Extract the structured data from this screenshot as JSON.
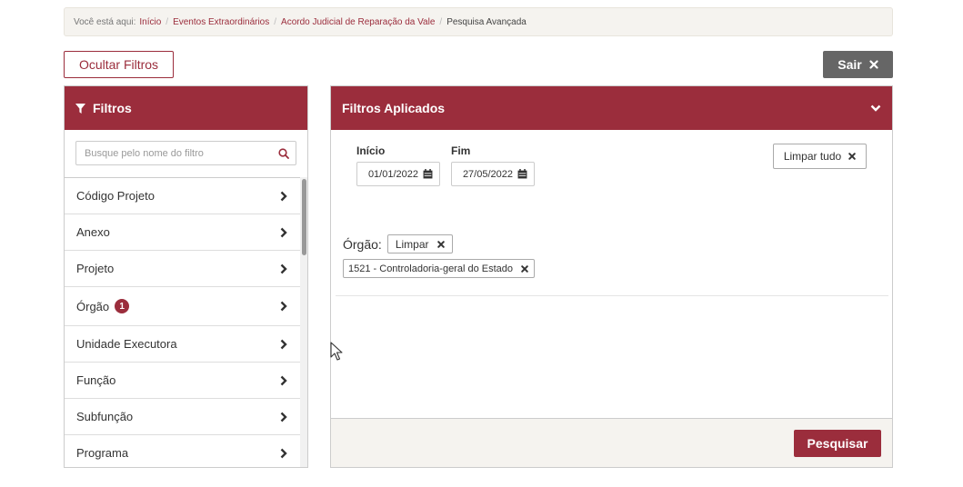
{
  "breadcrumb": {
    "prefix": "Você está aqui:",
    "items": [
      "Início",
      "Eventos Extraordinários",
      "Acordo Judicial de Reparação da Vale"
    ],
    "current": "Pesquisa Avançada",
    "separator": "/"
  },
  "toolbar": {
    "hide_filters_label": "Ocultar Filtros",
    "exit_label": "Sair"
  },
  "filters_panel": {
    "title": "Filtros",
    "search_placeholder": "Busque pelo nome do filtro",
    "items": [
      {
        "label": "Código Projeto"
      },
      {
        "label": "Anexo"
      },
      {
        "label": "Projeto"
      },
      {
        "label": "Órgão",
        "badge": "1"
      },
      {
        "label": "Unidade Executora"
      },
      {
        "label": "Função"
      },
      {
        "label": "Subfunção"
      },
      {
        "label": "Programa"
      }
    ]
  },
  "applied_panel": {
    "title": "Filtros Aplicados",
    "start_label": "Início",
    "start_value": "01/01/2022",
    "end_label": "Fim",
    "end_value": "27/05/2022",
    "clear_all_label": "Limpar tudo",
    "orgao_label": "Órgão:",
    "orgao_clear_label": "Limpar",
    "orgao_chip": "1521 - Controladoria-geral do Estado",
    "search_button": "Pesquisar"
  },
  "colors": {
    "brand": "#9b2d3c",
    "exit_button": "#666666",
    "breadcrumb_bg": "#f5f3ef"
  }
}
